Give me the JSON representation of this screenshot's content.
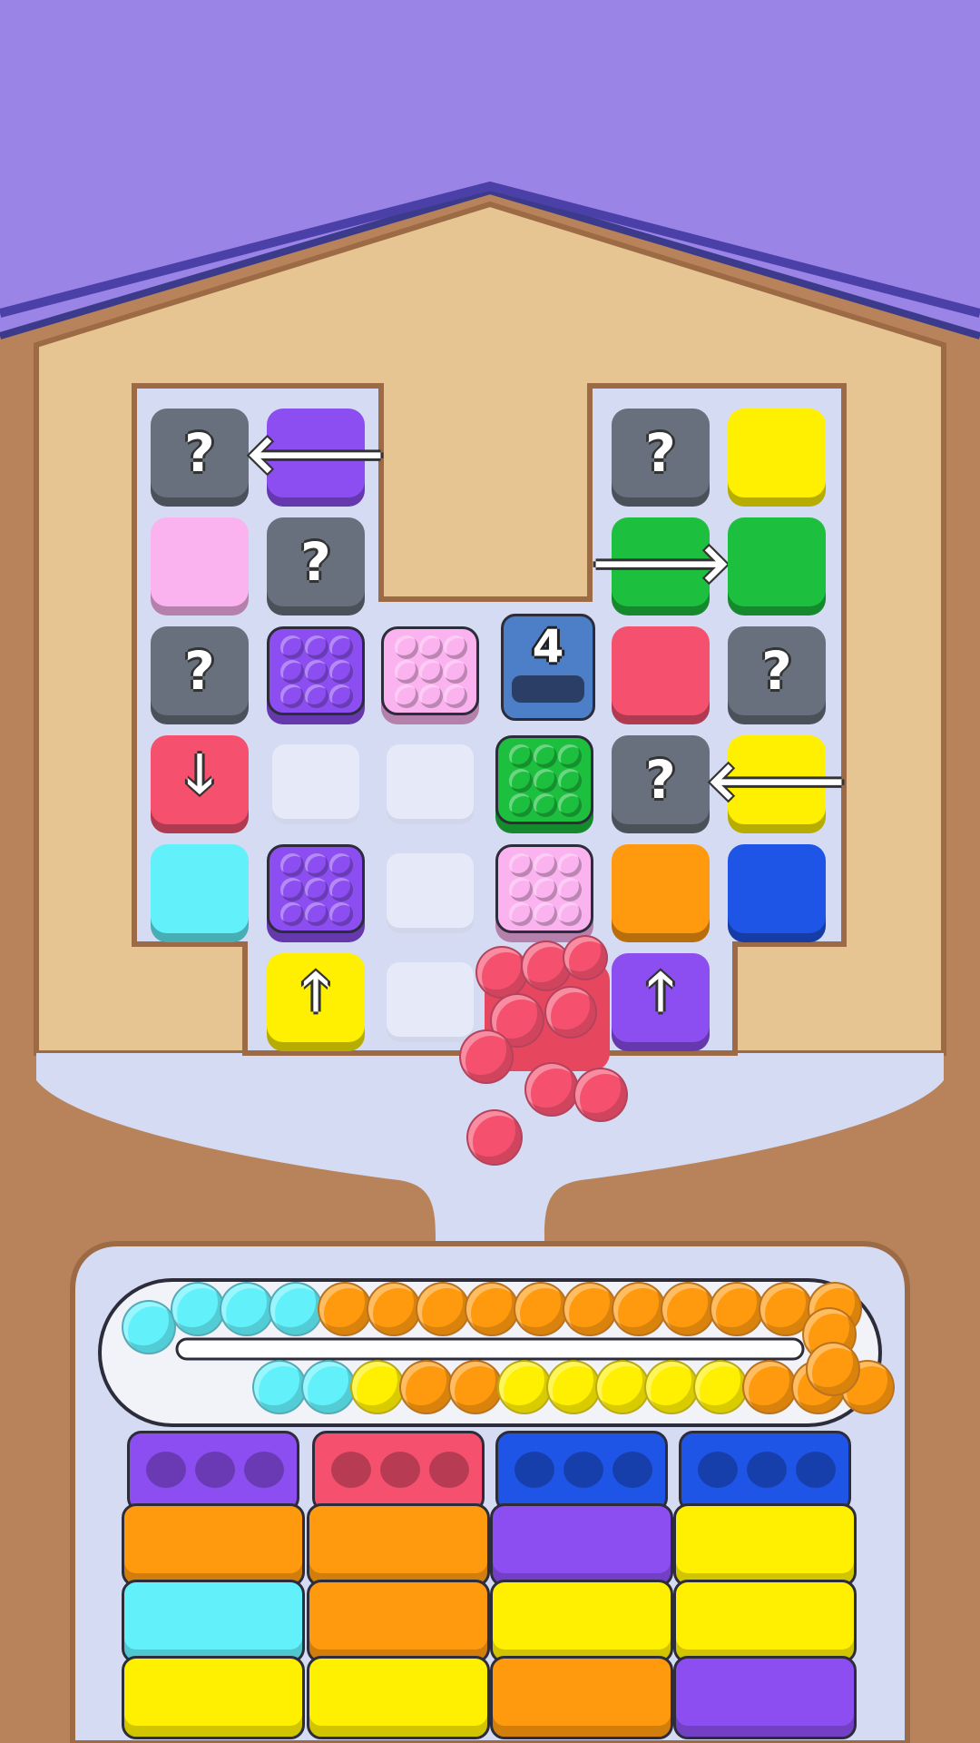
{
  "colors": {
    "sky": "#9a84e6",
    "roof": "#8c7ae2",
    "board": "#e7c593",
    "boardDark": "#b98a5a",
    "tray": "#d5dbf2",
    "gray": "#67707c",
    "purple": "#8c4ef0",
    "pink": "#fbb3ef",
    "green": "#1dbf3f",
    "yellow": "#fef000",
    "red": "#f5516f",
    "cyan": "#62f1fb",
    "orange": "#ff9a0f",
    "blue": "#1f55e6",
    "containerBlue": "#4d7ec8"
  },
  "grid": {
    "tiles": [
      {
        "row": 0,
        "col": 0,
        "color": "gray",
        "icon": "question-icon",
        "glyph": "?"
      },
      {
        "row": 0,
        "col": 1,
        "color": "purple",
        "icon": "arrow-left-icon",
        "glyph": "🡐"
      },
      {
        "row": 0,
        "col": 4,
        "color": "gray",
        "icon": "question-icon",
        "glyph": "?"
      },
      {
        "row": 0,
        "col": 5,
        "color": "yellow",
        "icon": "",
        "glyph": ""
      },
      {
        "row": 1,
        "col": 0,
        "color": "pink",
        "icon": "",
        "glyph": ""
      },
      {
        "row": 1,
        "col": 1,
        "color": "gray",
        "icon": "question-icon",
        "glyph": "?"
      },
      {
        "row": 1,
        "col": 4,
        "color": "green",
        "icon": "arrow-right-icon",
        "glyph": "🡒"
      },
      {
        "row": 1,
        "col": 5,
        "color": "green",
        "icon": "",
        "glyph": ""
      },
      {
        "row": 2,
        "col": 0,
        "color": "gray",
        "icon": "question-icon",
        "glyph": "?"
      },
      {
        "row": 2,
        "col": 1,
        "color": "purple",
        "icon": "bubble-block-icon",
        "glyph": ""
      },
      {
        "row": 2,
        "col": 2,
        "color": "pink",
        "icon": "bubble-block-icon",
        "glyph": ""
      },
      {
        "row": 2,
        "col": 4,
        "color": "red",
        "icon": "",
        "glyph": ""
      },
      {
        "row": 2,
        "col": 5,
        "color": "gray",
        "icon": "question-icon",
        "glyph": "?"
      },
      {
        "row": 3,
        "col": 0,
        "color": "red",
        "icon": "arrow-down-icon",
        "glyph": "🡓"
      },
      {
        "row": 3,
        "col": 3,
        "color": "green",
        "icon": "bubble-block-icon",
        "glyph": ""
      },
      {
        "row": 3,
        "col": 4,
        "color": "gray",
        "icon": "question-icon",
        "glyph": "?"
      },
      {
        "row": 3,
        "col": 5,
        "color": "yellow",
        "icon": "arrow-left-icon",
        "glyph": "🡐"
      },
      {
        "row": 4,
        "col": 0,
        "color": "cyan",
        "icon": "",
        "glyph": ""
      },
      {
        "row": 4,
        "col": 1,
        "color": "purple",
        "icon": "bubble-block-icon",
        "glyph": ""
      },
      {
        "row": 4,
        "col": 3,
        "color": "pink",
        "icon": "bubble-block-icon",
        "glyph": ""
      },
      {
        "row": 4,
        "col": 4,
        "color": "orange",
        "icon": "",
        "glyph": ""
      },
      {
        "row": 4,
        "col": 5,
        "color": "blue",
        "icon": "",
        "glyph": ""
      },
      {
        "row": 5,
        "col": 1,
        "color": "yellow",
        "icon": "arrow-up-icon",
        "glyph": "🡑"
      },
      {
        "row": 5,
        "col": 4,
        "color": "purple",
        "icon": "arrow-up-icon",
        "glyph": "🡑"
      }
    ],
    "emptySlots": [
      {
        "row": 3,
        "col": 1
      },
      {
        "row": 3,
        "col": 2
      },
      {
        "row": 4,
        "col": 2
      },
      {
        "row": 5,
        "col": 2
      }
    ]
  },
  "container": {
    "count": "4",
    "icon": "ball-container-icon"
  },
  "conveyor": {
    "topRow": [
      "cyan",
      "cyan",
      "cyan",
      "cyan",
      "orange",
      "orange",
      "orange",
      "orange",
      "orange",
      "orange",
      "orange",
      "orange",
      "orange",
      "orange",
      "orange"
    ],
    "bottomRow": [
      "cyan",
      "cyan",
      "yellow",
      "orange",
      "orange",
      "yellow",
      "yellow",
      "yellow",
      "yellow",
      "yellow",
      "orange",
      "orange",
      "orange"
    ]
  },
  "bins": [
    {
      "lid": "purple",
      "stack": [
        "orange",
        "cyan",
        "yellow"
      ]
    },
    {
      "lid": "red",
      "stack": [
        "orange",
        "orange",
        "yellow"
      ]
    },
    {
      "lid": "blue",
      "stack": [
        "purple",
        "yellow",
        "orange"
      ]
    },
    {
      "lid": "blue",
      "stack": [
        "yellow",
        "yellow",
        "purple"
      ]
    }
  ]
}
